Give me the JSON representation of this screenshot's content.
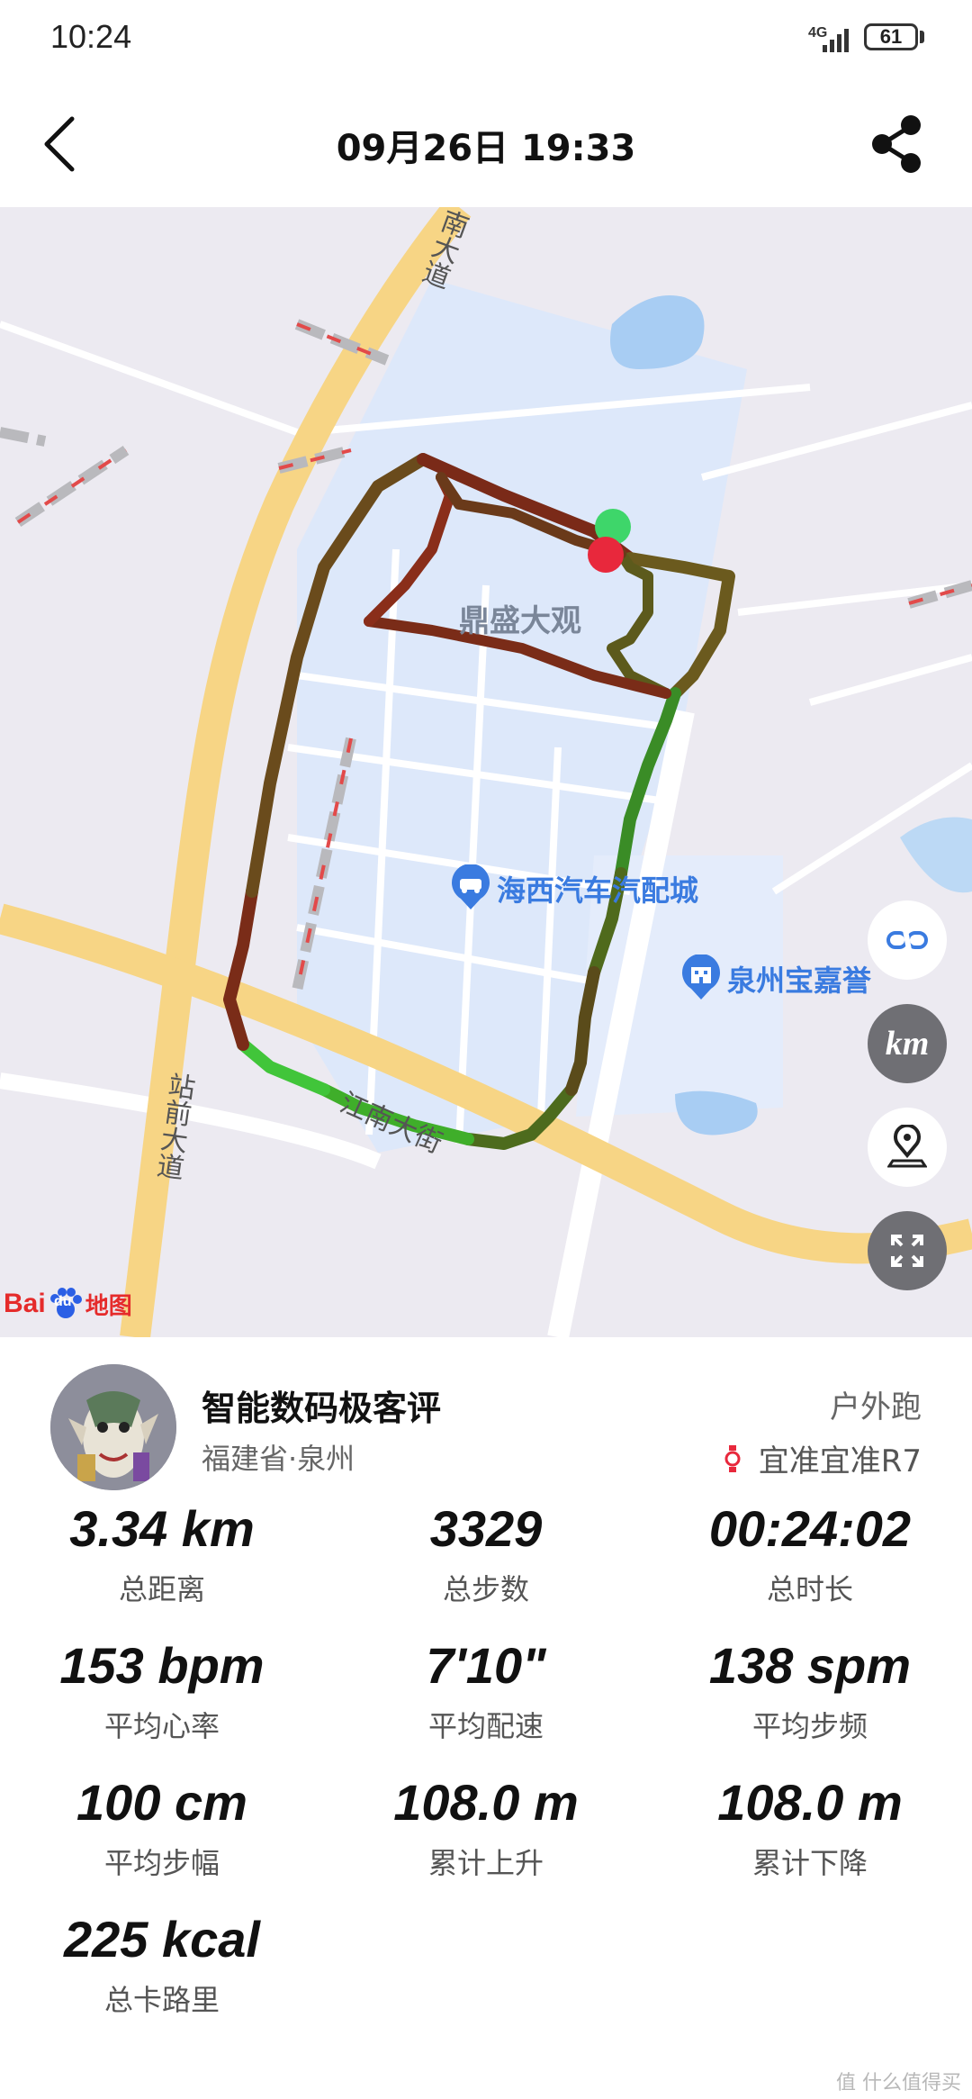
{
  "status_bar": {
    "time": "10:24",
    "network": "4G",
    "battery": "61"
  },
  "header": {
    "title": "09月26日 19:33",
    "back_icon": "chevron-left-icon",
    "share_icon": "share-icon"
  },
  "map": {
    "area_label": "鼎盛大观",
    "roads": {
      "road_top": "南大道",
      "road_left": "站前大道",
      "road_bottom": "江南大街"
    },
    "pois": [
      {
        "label": "海西汽车汽配城",
        "icon": "car-icon"
      },
      {
        "label": "泉州宝嘉誉",
        "icon": "building-icon"
      }
    ],
    "controls": [
      {
        "name": "link-icon"
      },
      {
        "name": "km-toggle",
        "label": "km"
      },
      {
        "name": "location-pin-icon"
      },
      {
        "name": "fullscreen-icon"
      }
    ],
    "logo": {
      "bai": "Bai",
      "du": "du",
      "ditu": "地图"
    },
    "route_colors": {
      "slow": "#8b2a1a",
      "mid": "#5d6b1f",
      "fast": "#2fcf3a"
    },
    "start_color": "#3ed66a",
    "end_color": "#e8283c"
  },
  "user": {
    "name": "智能数码极客评",
    "location": "福建省·泉州",
    "activity_type": "户外跑",
    "device": "宜准宜准R7"
  },
  "stats": [
    {
      "value": "3.34 km",
      "label": "总距离"
    },
    {
      "value": "3329",
      "label": "总步数"
    },
    {
      "value": "00:24:02",
      "label": "总时长"
    },
    {
      "value": "153 bpm",
      "label": "平均心率"
    },
    {
      "value": "7'10\"",
      "label": "平均配速"
    },
    {
      "value": "138 spm",
      "label": "平均步频"
    },
    {
      "value": "100 cm",
      "label": "平均步幅"
    },
    {
      "value": "108.0 m",
      "label": "累计上升"
    },
    {
      "value": "108.0 m",
      "label": "累计下降"
    },
    {
      "value": "225 kcal",
      "label": "总卡路里"
    }
  ],
  "watermark": "值 什么值得买"
}
